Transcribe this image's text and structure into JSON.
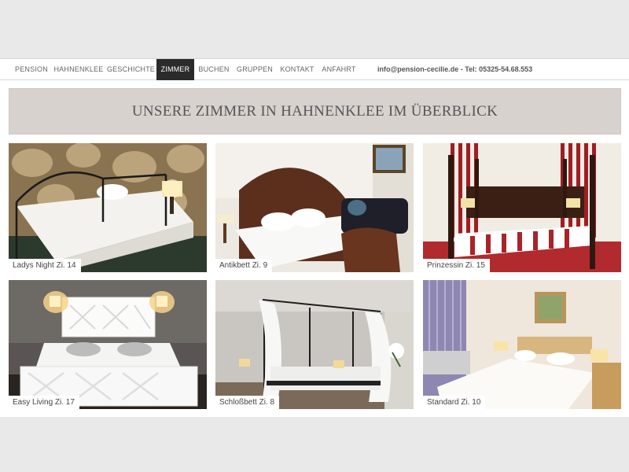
{
  "nav": {
    "items": [
      {
        "label": "PENSION"
      },
      {
        "label": "HAHNENKLEE"
      },
      {
        "label": "GESCHICHTE"
      },
      {
        "label": "ZIMMER"
      },
      {
        "label": "BUCHEN"
      },
      {
        "label": "GRUPPEN"
      },
      {
        "label": "KONTAKT"
      },
      {
        "label": "ANFAHRT"
      }
    ],
    "active_label": "ZIMMER",
    "contact": "info@pension-cecilie.de - Tel: 05325-54.68.553"
  },
  "heading": "UNSERE ZIMMER IN HAHNENKLEE IM ÜBERBLICK",
  "rooms": [
    {
      "caption": "Ladys Night Zi. 14"
    },
    {
      "caption": "Antikbett Zi. 9"
    },
    {
      "caption": "Prinzessin Zi. 15"
    },
    {
      "caption": "Easy Living Zi. 17"
    },
    {
      "caption": "Schloßbett Zi. 8"
    },
    {
      "caption": "Standard Zi. 10"
    }
  ],
  "colors": {
    "nav_active_bg": "#2b2b2b",
    "heading_bg": "#d8d2cf",
    "page_bg": "#e9e9e9"
  }
}
